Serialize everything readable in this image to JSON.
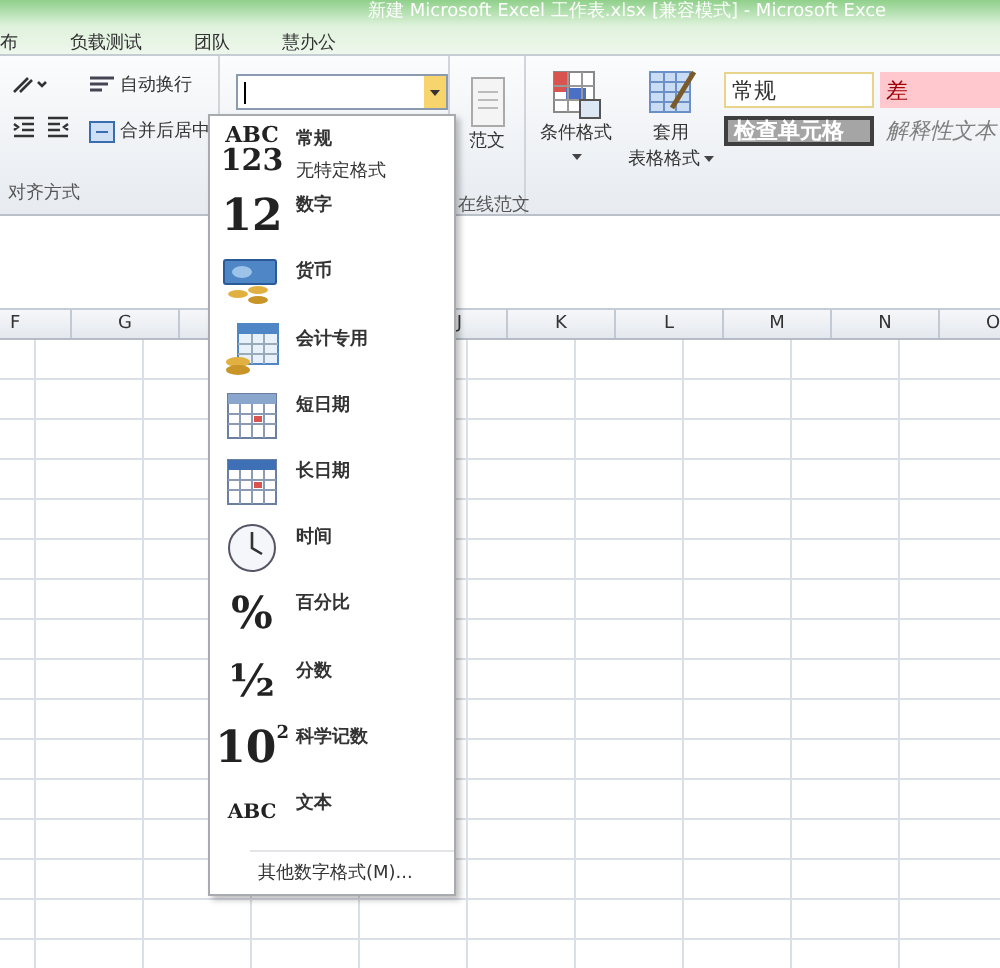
{
  "window": {
    "title": "新建 Microsoft Excel 工作表.xlsx  [兼容模式]  -  Microsoft Exce"
  },
  "tabs": [
    {
      "label": "布",
      "selected": false
    },
    {
      "label": "负载测试",
      "selected": false
    },
    {
      "label": "团队",
      "selected": false
    },
    {
      "label": "慧办公",
      "selected": false
    }
  ],
  "ribbon": {
    "alignment": {
      "wrap_text": "自动换行",
      "merge_center": "合并后居中",
      "label": "对齐方式"
    },
    "templates": {
      "button": "范文",
      "label": "在线范文"
    },
    "styles": {
      "conditional": "条件格式",
      "format_table": [
        "套用",
        "表格格式"
      ],
      "cells": [
        {
          "label": "常规",
          "kind": "normal"
        },
        {
          "label": "差",
          "kind": "bad"
        },
        {
          "label": "检查单元格",
          "kind": "check"
        },
        {
          "label": "解释性文本",
          "kind": "explanatory"
        }
      ]
    }
  },
  "columns": [
    "F",
    "G",
    "J",
    "K",
    "L",
    "M",
    "N",
    "O"
  ],
  "format_menu": {
    "items": [
      {
        "kind": "glyph",
        "glyph": [
          "ABC",
          "123"
        ],
        "label": "常规",
        "sub": "无特定格式"
      },
      {
        "kind": "glyph",
        "glyph": [
          "12"
        ],
        "label": "数字"
      },
      {
        "kind": "currency",
        "label": "货币"
      },
      {
        "kind": "accounting",
        "label": "会计专用"
      },
      {
        "kind": "short-date",
        "label": "短日期"
      },
      {
        "kind": "long-date",
        "label": "长日期"
      },
      {
        "kind": "time",
        "label": "时间"
      },
      {
        "kind": "glyph",
        "glyph": [
          "%"
        ],
        "label": "百分比"
      },
      {
        "kind": "glyph",
        "glyph": [
          "½"
        ],
        "label": "分数"
      },
      {
        "kind": "glyph",
        "glyph": [
          "10$^{2}$"
        ],
        "label": "科学记数"
      },
      {
        "kind": "glyph",
        "glyph": [
          "ABC"
        ],
        "label": "文本",
        "small": true
      }
    ],
    "footer": "其他数字格式(M)..."
  }
}
